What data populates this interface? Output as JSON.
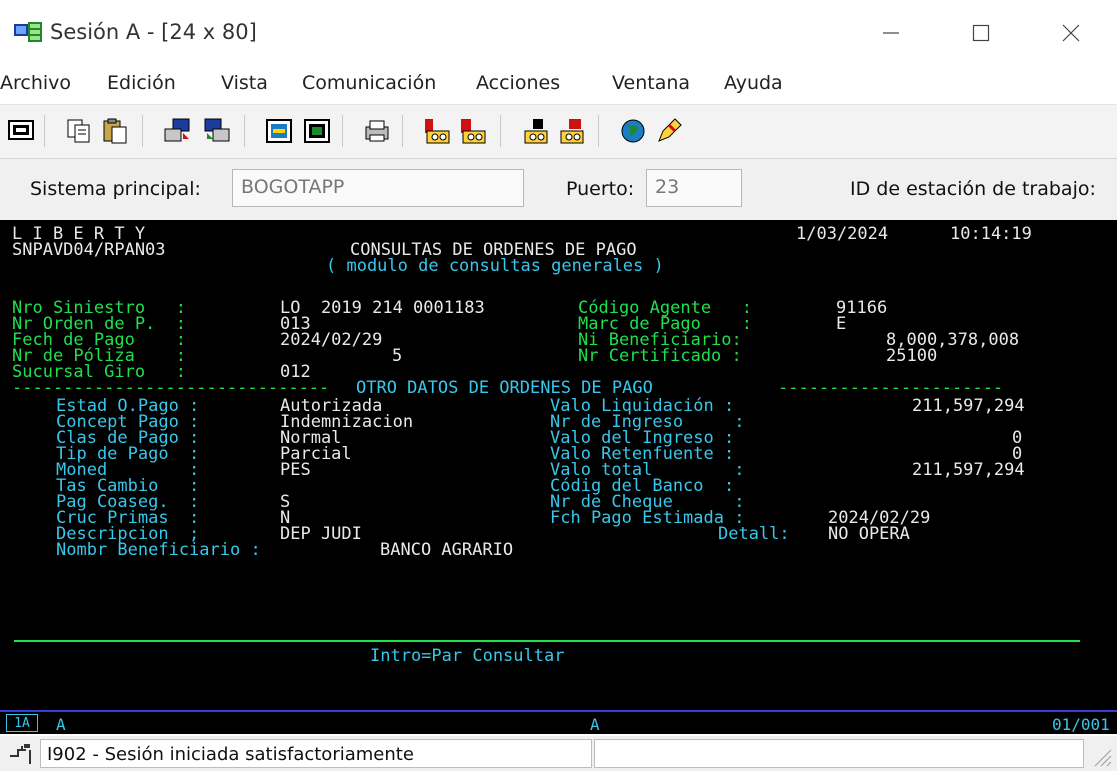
{
  "window": {
    "title": "Sesión A - [24 x 80]",
    "minimize_glyph": "—",
    "maximize_glyph": "☐",
    "close_glyph": "✕"
  },
  "menu": [
    "Archivo",
    "Edición",
    "Vista",
    "Comunicación",
    "Acciones",
    "Ventana",
    "Ayuda"
  ],
  "toolbar": {
    "icons": [
      "display-icon",
      "copy-icon",
      "paste-icon",
      "send-file-icon",
      "receive-file-icon",
      "macro-record-icon",
      "macro-play-icon",
      "print-screen-icon",
      "bell-icon",
      "red-bell-icon",
      "keypad-icon",
      "keypad-red-icon",
      "globe-icon",
      "pen-icon"
    ]
  },
  "connection": {
    "host_label": "Sistema principal:",
    "host_value": "BOGOTAPP",
    "port_label": "Puerto:",
    "port_value": "23",
    "station_label": "ID de estación de trabajo:"
  },
  "terminal": {
    "header": {
      "app_name": "L I B E R T Y",
      "program": "SNPAVD04/RPAN03",
      "title": "CONSULTAS DE ORDENES DE PAGO",
      "subtitle": "( modulo de consultas generales )",
      "date": "1/03/2024",
      "time": "10:14:19"
    },
    "section1": {
      "siniestro_label": "Nro Siniestro   :",
      "siniestro_value": "LO  2019 214 0001183",
      "agente_label": "Código Agente   :",
      "agente_value": "91166",
      "orden_label": "Nr Orden de P.  :",
      "orden_value": "013",
      "marc_label": "Marc de Pago    :",
      "marc_value": "E",
      "fecha_label": "Fech de Pago    :",
      "fecha_value": "2024/02/29",
      "benef_label": "Ni Beneficiario:",
      "benef_value": "8,000,378,008",
      "poliza_label": "Nr de Póliza    :",
      "poliza_value": "5",
      "cert_label": "Nr Certificado :",
      "cert_value": "25100",
      "sucursal_label": "Sucursal Giro   :",
      "sucursal_value": "012"
    },
    "divider_title": "OTRO DATOS DE ORDENES DE PAGO",
    "section2": {
      "estad_label": "Estad O.Pago :",
      "estad_value": "Autorizada",
      "liq_label": "Valo Liquidación :",
      "liq_value": "211,597,294",
      "concept_label": "Concept Pago :",
      "concept_value": "Indemnizacion",
      "ingreso_nr_label": "Nr de Ingreso     :",
      "clas_label": "Clas de Pago :",
      "clas_value": "Normal",
      "ingreso_val_label": "Valo del Ingreso :",
      "ingreso_val_value": "0",
      "tip_label": "Tip de Pago  :",
      "tip_value": "Parcial",
      "retenfuente_label": "Valo Retenfuente :",
      "retenfuente_value": "0",
      "moned_label": "Moned        :",
      "moned_value": "PES",
      "total_label": "Valo total        :",
      "total_value": "211,597,294",
      "tas_label": "Tas Cambio   :",
      "banco_label": "Códig del Banco  :",
      "coaseg_label": "Pag Coaseg.  :",
      "coaseg_value": "S",
      "cheque_label": "Nr de Cheque      :",
      "cruc_label": "Cruc Primas  :",
      "cruc_value": "N",
      "fch_est_label": "Fch Pago Estimada :",
      "fch_est_value": "2024/02/29",
      "desc_label": "Descripcion  ;",
      "desc_value": "DEP JUDI",
      "detall_label": "Detall:",
      "detall_value": "NO OPERA",
      "nombre_label": "Nombr Beneficiario :",
      "nombre_value": "BANCO AGRARIO"
    },
    "footer_keys": "Intro=Par Consultar"
  },
  "oia": {
    "box": "1A",
    "mode1": "A",
    "mode2": "A",
    "cursor": "01/001"
  },
  "status": {
    "message": "I902 - Sesión iniciada satisfactoriamente",
    "panel2": ""
  },
  "colors": {
    "terminal_bg": "#000000",
    "field_green": "#1ee14d",
    "value_white": "#e9e9e9",
    "accent_cyan": "#37c7ec",
    "oia_border": "#3a3ad8"
  }
}
